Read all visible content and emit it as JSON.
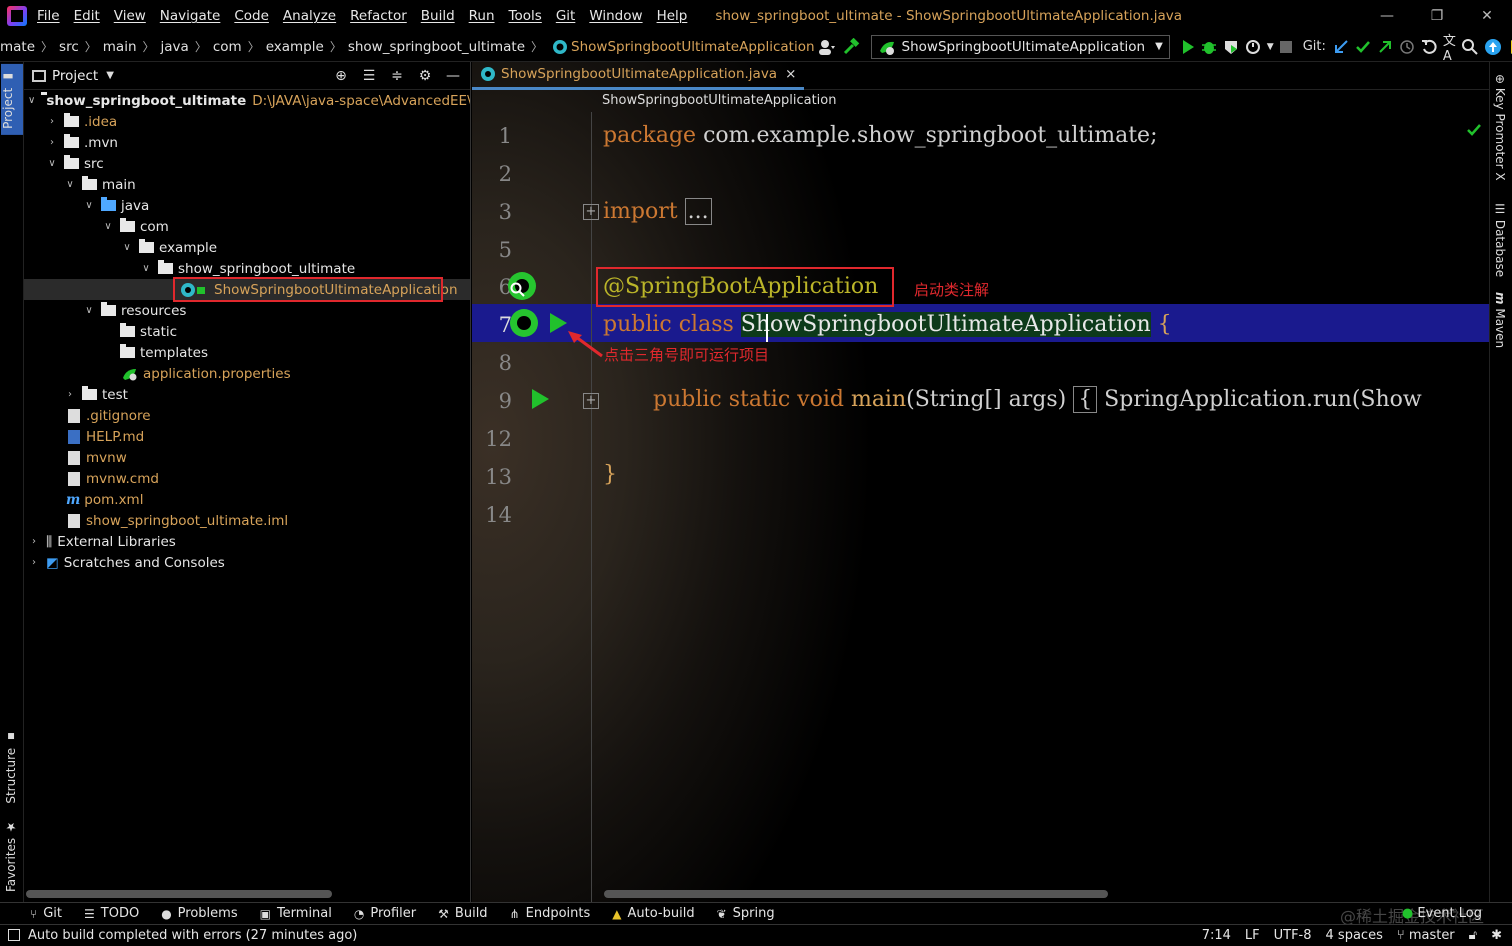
{
  "menu": [
    "File",
    "Edit",
    "View",
    "Navigate",
    "Code",
    "Analyze",
    "Refactor",
    "Build",
    "Run",
    "Tools",
    "Git",
    "Window",
    "Help"
  ],
  "window_title": "show_springboot_ultimate - ShowSpringbootUltimateApplication.java",
  "breadcrumbs": [
    "mate",
    "src",
    "main",
    "java",
    "com",
    "example",
    "show_springboot_ultimate",
    "ShowSpringbootUltimateApplication"
  ],
  "run_config": "ShowSpringbootUltimateApplication",
  "git_label": "Git:",
  "left_stripe": {
    "project": "Project",
    "structure": "Structure",
    "favorites": "Favorites"
  },
  "project_pane": {
    "title": "Project",
    "tree": [
      {
        "name": "show_springboot_ultimate",
        "path": "D:\\JAVA\\java-space\\AdvancedEE\\sprir"
      },
      {
        "name": ".idea"
      },
      {
        "name": ".mvn"
      },
      {
        "name": "src"
      },
      {
        "name": "main"
      },
      {
        "name": "java"
      },
      {
        "name": "com"
      },
      {
        "name": "example"
      },
      {
        "name": "show_springboot_ultimate"
      },
      {
        "name": "ShowSpringbootUltimateApplication"
      },
      {
        "name": "resources"
      },
      {
        "name": "static"
      },
      {
        "name": "templates"
      },
      {
        "name": "application.properties"
      },
      {
        "name": "test"
      },
      {
        "name": ".gitignore"
      },
      {
        "name": "HELP.md"
      },
      {
        "name": "mvnw"
      },
      {
        "name": "mvnw.cmd"
      },
      {
        "name": "pom.xml"
      },
      {
        "name": "show_springboot_ultimate.iml"
      },
      {
        "name": "External Libraries"
      },
      {
        "name": "Scratches and Consoles"
      }
    ]
  },
  "editor": {
    "tab_label": "ShowSpringbootUltimateApplication.java",
    "close_glyph": "×",
    "breadcrumb": "ShowSpringbootUltimateApplication",
    "line_numbers": [
      "1",
      "2",
      "3",
      "5",
      "6",
      "7",
      "8",
      "9",
      "12",
      "13",
      "14"
    ],
    "code": {
      "l1_kw": "package",
      "l1_rest": " com.example.show_springboot_ultimate;",
      "l3_kw": "import",
      "l3_fold": "...",
      "l6_ann": "@SpringBootApplication",
      "l7_kw": "public class ",
      "l7_cls": "ShowSpringbootUltimateApplication",
      "l7_brace": " {",
      "l9_kw": "public static void ",
      "l9_method": "main",
      "l9_params": "(String[] args) ",
      "l9_brace": "{",
      "l9_rest": " SpringApplication.run(Show",
      "l13": "}"
    },
    "annotation_note": "启动类注解",
    "run_note": "点击三角号即可运行项目"
  },
  "right_stripe": {
    "key_promoter": "Key Promoter X",
    "database": "Database",
    "maven": "Maven"
  },
  "toolwindows": [
    "Git",
    "TODO",
    "Problems",
    "Terminal",
    "Profiler",
    "Build",
    "Endpoints",
    "Auto-build",
    "Spring"
  ],
  "event_log": "Event Log",
  "watermark": "@稀土掘金技术社区",
  "status": {
    "message": "Auto build completed with errors (27 minutes ago)",
    "position": "7:14",
    "line_sep": "LF",
    "encoding": "UTF-8",
    "indent": "4 spaces",
    "branch": "master"
  },
  "colors": {
    "accent": "#2f5fb3",
    "annotation_red": "#e0282d",
    "run_green": "#21c12c",
    "keyword": "#cc7832"
  }
}
